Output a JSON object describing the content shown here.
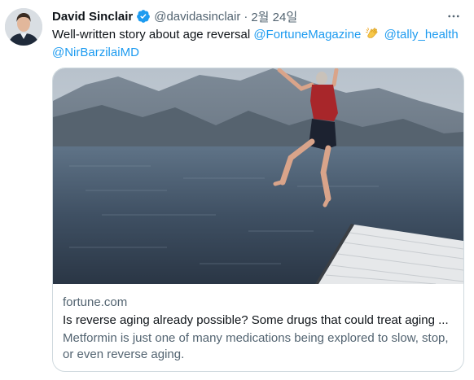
{
  "tweet": {
    "display_name": "David Sinclair",
    "verified_icon": "verified-badge-icon",
    "handle": "@davidasinclair",
    "separator": "·",
    "date": "2월 24일",
    "more_icon": "more-horizontal-icon",
    "text_before": "Well-written story about age reversal ",
    "mention_1": "@FortuneMagazine",
    "emoji_icon": "clapping-hands-icon",
    "mention_2": "@tally_health",
    "mention_3": "@NirBarzilaiMD"
  },
  "card": {
    "image_description_icon": "photo-woman-jumping-into-lake",
    "domain": "fortune.com",
    "title": "Is reverse aging already possible? Some drugs that could treat aging ...",
    "description": "Metformin is just one of many medications being explored to slow, stop, or even reverse aging."
  },
  "colors": {
    "link": "#1d9bf0",
    "secondary_text": "#536471",
    "border": "#cfd9de"
  }
}
